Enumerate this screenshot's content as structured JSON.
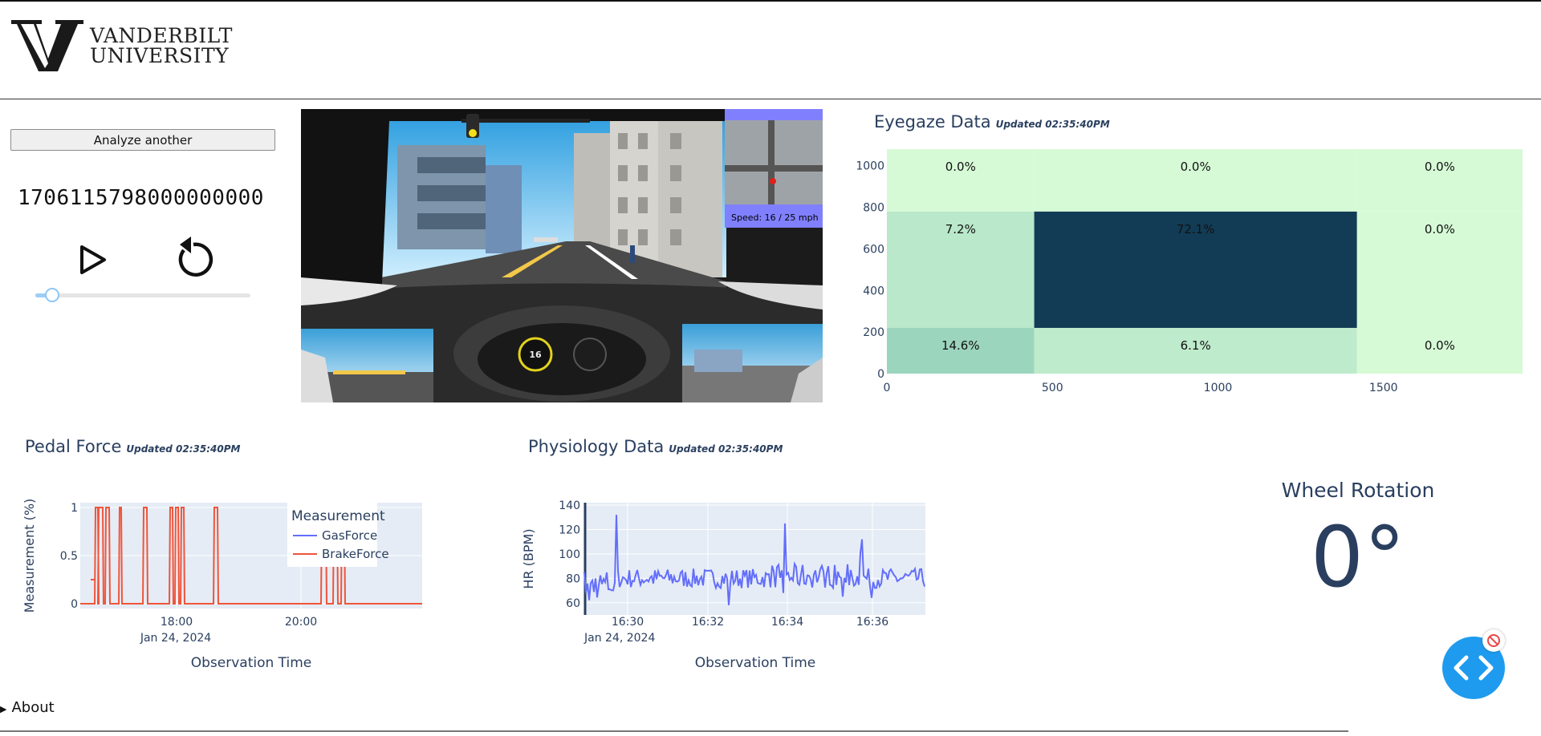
{
  "header": {
    "logo_line1": "VANDERBILT",
    "logo_line2": "UNIVERSITY"
  },
  "controls": {
    "analyze_label": "Analyze another",
    "timestamp": "1706115798000000000",
    "play_icon": "play-icon",
    "replay_icon": "replay-icon",
    "slider_value": 0.08,
    "accent": "#9ecdf5"
  },
  "sim": {
    "speed_text": "Speed:  16 / 25 mph",
    "speedo_value": "16"
  },
  "eyegaze": {
    "title": "Eyegaze Data",
    "updated": "Updated 02:35:40PM",
    "chart_data": {
      "type": "heatmap",
      "x_ticks": [
        "0",
        "500",
        "1000",
        "1500"
      ],
      "y_ticks": [
        "0",
        "200",
        "400",
        "600",
        "800",
        "1000"
      ],
      "x_range": [
        0,
        1920
      ],
      "y_range": [
        0,
        1080
      ],
      "x_bins": [
        [
          0,
          445
        ],
        [
          445,
          1420
        ],
        [
          1420,
          1920
        ]
      ],
      "y_bins": [
        [
          0,
          220
        ],
        [
          220,
          780
        ],
        [
          780,
          1080
        ]
      ],
      "cells": [
        [
          "14.6%",
          "6.1%",
          "0.0%"
        ],
        [
          "7.2%",
          "72.1%",
          "0.0%"
        ],
        [
          "0.0%",
          "0.0%",
          "0.0%"
        ]
      ],
      "values": [
        [
          14.6,
          6.1,
          0.0
        ],
        [
          7.2,
          72.1,
          0.0
        ],
        [
          0.0,
          0.0,
          0.0
        ]
      ]
    }
  },
  "pedal": {
    "title": "Pedal Force",
    "updated": "Updated 02:35:40PM",
    "chart_data": {
      "type": "line",
      "xlabel": "Observation Time",
      "ylabel": "Measurement (%)",
      "x_ticks": [
        "18:00",
        "20:00"
      ],
      "x_date": "Jan 24, 2024",
      "y_ticks": [
        "0",
        "0.5",
        "1"
      ],
      "ylim": [
        0,
        1
      ],
      "legend_title": "Measurement",
      "series": [
        {
          "name": "GasForce",
          "color": "#636efa"
        },
        {
          "name": "BrakeForce",
          "color": "#ef553b"
        }
      ]
    }
  },
  "physio": {
    "title": "Physiology Data",
    "updated": "Updated 02:35:40PM",
    "chart_data": {
      "type": "line",
      "xlabel": "Observation Time",
      "ylabel": "HR (BPM)",
      "x_ticks": [
        "16:30",
        "16:32",
        "16:34",
        "16:36"
      ],
      "x_date": "Jan 24, 2024",
      "y_ticks": [
        "60",
        "80",
        "100",
        "120",
        "140"
      ],
      "ylim": [
        50,
        142
      ],
      "series": [
        {
          "name": "HR",
          "color": "#636efa"
        }
      ]
    }
  },
  "wheel": {
    "title": "Wheel Rotation",
    "value": "0°"
  },
  "footer": {
    "about_label": "About"
  }
}
